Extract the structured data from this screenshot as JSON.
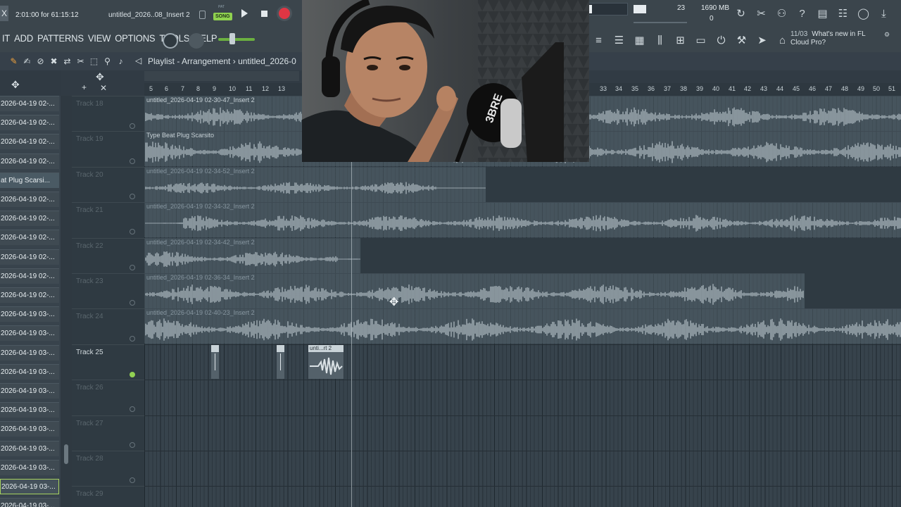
{
  "topbar": {
    "close": "X",
    "hint": "2:01:00 for 61:15:12",
    "title": "untitled_2026..08_Insert 2",
    "song_label": "SONG",
    "pat_label": "PAT",
    "cpu": "23",
    "memory": "1690 MB",
    "voices": "0",
    "icons": [
      "refresh-icon",
      "scissors-icon",
      "microphone-icon",
      "help-icon",
      "save-icon",
      "export-icon",
      "chat-icon",
      "download-icon"
    ]
  },
  "menu": {
    "items": [
      "IT",
      "ADD",
      "PATTERNS",
      "VIEW",
      "OPTIONS",
      "TOOLS",
      "HELP"
    ]
  },
  "news": {
    "date": "11/03",
    "line1": "What's new in FL",
    "line2": "Cloud Pro?"
  },
  "playlist": {
    "title": "Playlist - Arrangement",
    "breadcrumb": "untitled_2026-0",
    "bars": [
      "5",
      "6",
      "7",
      "8",
      "9",
      "10",
      "11",
      "12",
      "13",
      "33",
      "34",
      "35",
      "36",
      "37",
      "38",
      "39",
      "40",
      "41",
      "42",
      "43",
      "44",
      "45",
      "46",
      "47",
      "48",
      "49",
      "50",
      "51"
    ]
  },
  "patterns": [
    "2026-04-19 02-...",
    "2026-04-19 02-...",
    "2026-04-19 02-...",
    "2026-04-19 02-...",
    "at Plug Scarsi...",
    "2026-04-19 02-...",
    "2026-04-19 02-...",
    "2026-04-19 02-...",
    "2026-04-19 02-...",
    "2026-04-19 02-...",
    "2026-04-19 02-...",
    "2026-04-19 03-...",
    "2026-04-19 03-...",
    "2026-04-19 03-...",
    "2026-04-19 03-...",
    "2026-04-19 03-...",
    "2026-04-19 03-...",
    "2026-04-19 03-...",
    "2026-04-19 03-...",
    "2026-04-19 03-...",
    "2026-04-19 03-...",
    "2026-04-19 03-...",
    "2026-04-19 03-..."
  ],
  "tracks": [
    {
      "name": "Track 18",
      "active": false
    },
    {
      "name": "Track 19",
      "active": false
    },
    {
      "name": "Track 20",
      "active": false
    },
    {
      "name": "Track 21",
      "active": false
    },
    {
      "name": "Track 22",
      "active": false
    },
    {
      "name": "Track 23",
      "active": false
    },
    {
      "name": "Track 24",
      "active": false
    },
    {
      "name": "Track 25",
      "active": true
    },
    {
      "name": "Track 26",
      "active": false
    },
    {
      "name": "Track 27",
      "active": false
    },
    {
      "name": "Track 28",
      "active": false
    },
    {
      "name": "Track 29",
      "active": false
    }
  ],
  "clips": [
    {
      "label": "untitled_2026-04-19 02-30-47_Insert 2",
      "dim": false
    },
    {
      "label": "Type Beat Plug Scarsito",
      "dim": false
    },
    {
      "label": "untitled_2026-04-19 02-34-52_Insert 2",
      "dim": true
    },
    {
      "label": "untitled_2026-04-19 02-34-32_Insert 2",
      "dim": true
    },
    {
      "label": "untitled_2026-04-19 02-34-42_Insert 2",
      "dim": true
    },
    {
      "label": "untitled_2026-04-19 02-36-34_Insert 2",
      "dim": true
    },
    {
      "label": "untitled_2026-04-19 02-40-23_Insert 2",
      "dim": true
    }
  ],
  "small_clip_label": "unti...rt 2"
}
